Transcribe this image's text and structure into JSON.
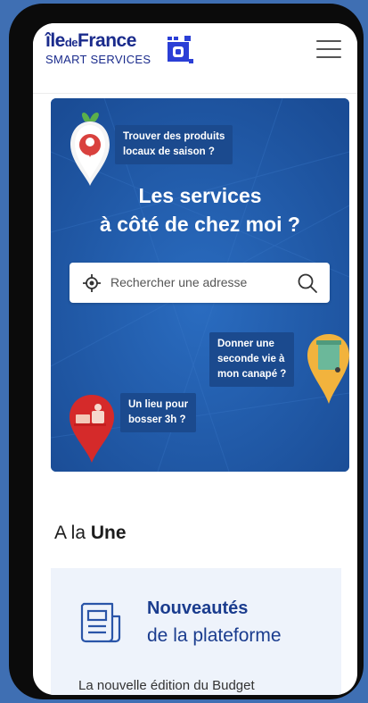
{
  "brand": {
    "name_prefix": "île",
    "name_small": "de",
    "name_suffix": "France",
    "tagline": "SMART SERVICES"
  },
  "colors": {
    "brand_blue": "#1a2b8c",
    "hero_blue": "#1f57a3",
    "bubble_blue": "#1b4a8e",
    "news_bg": "#eef3fb"
  },
  "header": {
    "menu_icon": "hamburger-icon"
  },
  "hero": {
    "title_line1": "Les services",
    "title_line2": "à côté de chez moi ?",
    "bubble_produits": {
      "line1": "Trouver des produits",
      "line2": "locaux de saison ?"
    },
    "bubble_canape": {
      "line1": "Donner une",
      "line2": "seconde vie à",
      "line3": "mon canapé ?"
    },
    "bubble_lieu": {
      "line1": "Un lieu pour",
      "line2": "bosser 3h ?"
    },
    "search": {
      "placeholder": "Rechercher une adresse",
      "value": "",
      "locate_icon": "crosshair-icon",
      "submit_icon": "search-icon"
    }
  },
  "une": {
    "title_prefix": "A la ",
    "title_bold": "Une"
  },
  "news": {
    "icon": "newspaper-icon",
    "title_bold": "Nouveautés",
    "title_regular": "de la plateforme",
    "excerpt": "La nouvelle édition du Budget"
  }
}
